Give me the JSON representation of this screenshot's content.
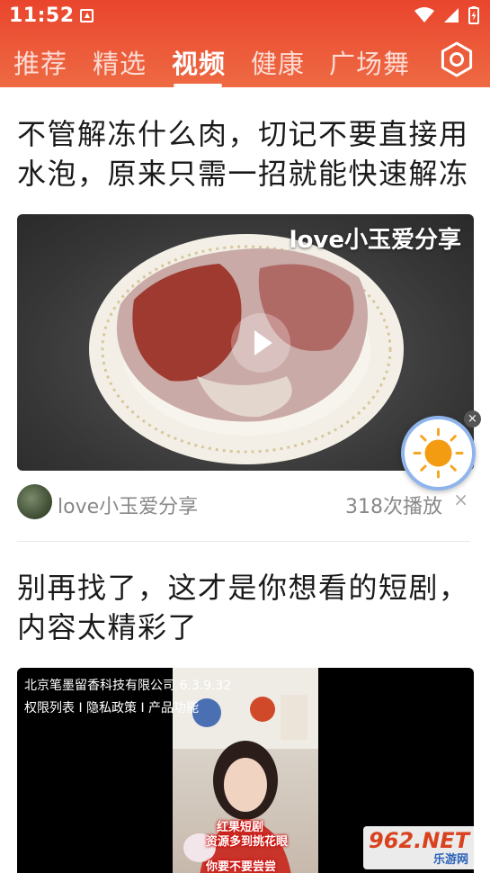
{
  "status_bar": {
    "time": "11:52"
  },
  "tabs": [
    {
      "label": "推荐"
    },
    {
      "label": "精选"
    },
    {
      "label": "视频"
    },
    {
      "label": "健康"
    },
    {
      "label": "广场舞"
    }
  ],
  "active_tab": "视频",
  "feed": [
    {
      "title_line1": "不管解冻什么肉，切记不要直接用",
      "title_line2": "水泡，原来只需一招就能快速解冻",
      "video_overlay": "love小玉爱分享",
      "author": "love小玉爱分享",
      "play_count": "318次播放",
      "dismiss_label": "×"
    },
    {
      "title_line1": "别再找了，这才是你想看的短剧，",
      "title_line2": "内容太精彩了",
      "company_line": "北京笔墨留香科技有限公司  6.3.9.32",
      "links_line": "权限列表 I 隐私政策 I 产品功能",
      "caption_line1": "红果短剧",
      "caption_line2": "资源多到挑花眼",
      "caption_line3": "你要不要尝尝"
    }
  ],
  "floating": {
    "close_label": "×"
  },
  "watermark": {
    "main": "962.NET",
    "sub": "乐游网"
  },
  "colors": {
    "header": "#e9452d",
    "accent_sun": "#f5a623"
  },
  "icons": [
    "app-notification-icon",
    "wifi-icon",
    "battery-icon",
    "settings-icon",
    "play-icon",
    "sun-icon",
    "close-icon"
  ]
}
